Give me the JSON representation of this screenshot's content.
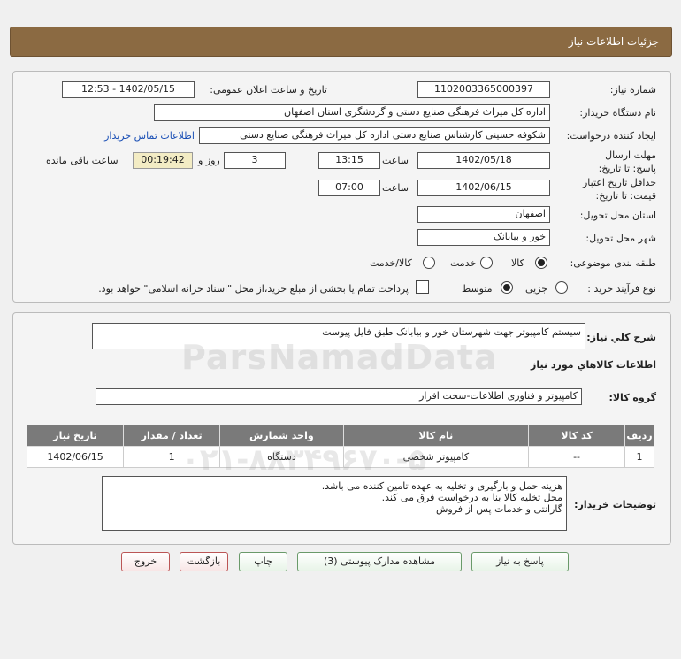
{
  "header": {
    "title": "جزئیات اطلاعات نیاز"
  },
  "fields": {
    "need_number_label": "شماره نیاز:",
    "need_number": "1102003365000397",
    "announce_label": "تاریخ و ساعت اعلان عمومی:",
    "announce_value": "1402/05/15 - 12:53",
    "buyer_org_label": "نام دستگاه خریدار:",
    "buyer_org": "اداره کل میراث فرهنگی  صنایع دستی و گردشگری استان اصفهان",
    "creator_label": "ایجاد کننده درخواست:",
    "creator": "شکوفه حسینی کارشناس صنایع دستی اداره کل میراث فرهنگی  صنایع دستی",
    "contact_link": "اطلاعات تماس خریدار",
    "deadline_label": "مهلت ارسال پاسخ: تا تاریخ:",
    "deadline_date": "1402/05/18",
    "time_label": "ساعت",
    "deadline_time": "13:15",
    "days_value": "3",
    "days_label": "روز و",
    "remaining_time": "00:19:42",
    "remaining_label": "ساعت باقی مانده",
    "validity_label": "حداقل تاریخ اعتبار قیمت: تا تاریخ:",
    "validity_date": "1402/06/15",
    "validity_time": "07:00",
    "province_label": "استان محل تحویل:",
    "province": "اصفهان",
    "city_label": "شهر محل تحویل:",
    "city": "خور و بیابانک",
    "category_label": "طبقه بندی موضوعی:",
    "category_options": [
      "کالا",
      "خدمت",
      "کالا/خدمت"
    ],
    "process_label": "نوع فرآیند خرید :",
    "process_options": [
      "جزیی",
      "متوسط"
    ],
    "payment_note": "پرداخت تمام یا بخشی از مبلغ خرید،از محل \"اسناد خزانه اسلامی\" خواهد بود."
  },
  "details": {
    "summary_label": "شرح كلي نياز:",
    "summary": "سیستم کامپیوتر جهت شهرستان خور و بیابانک طبق فایل پیوست",
    "goods_info_title": "اطلاعات كالاهاي مورد نياز",
    "goods_group_label": "گروه کالا:",
    "goods_group": "کامپیوتر و فناوری اطلاعات-سخت افزار",
    "table": {
      "headers": [
        "ردیف",
        "کد کالا",
        "نام کالا",
        "واحد شمارش",
        "تعداد / مقدار",
        "تاریخ نیاز"
      ],
      "rows": [
        [
          "1",
          "--",
          "کامپیوتر شخصی",
          "دستگاه",
          "1",
          "1402/06/15"
        ]
      ]
    },
    "buyer_notes_label": "توضیحات خریدار:",
    "buyer_notes": [
      "هزینه حمل و بارگیری و تخلیه به عهده تامین کننده می باشد.",
      "محل تخلیه کالا بنا به درخواست فرق می کند.",
      "گارانتی و خدمات پس از فروش"
    ]
  },
  "buttons": {
    "reply": "پاسخ به نیاز",
    "attachments": "مشاهده مدارک پیوستی (3)",
    "print": "چاپ",
    "back": "بازگشت",
    "exit": "خروج"
  },
  "watermark": {
    "brand": "ParsNamadData",
    "phone": "۰۲۱-۸۸۳۴۹۶۷۰-۵"
  }
}
